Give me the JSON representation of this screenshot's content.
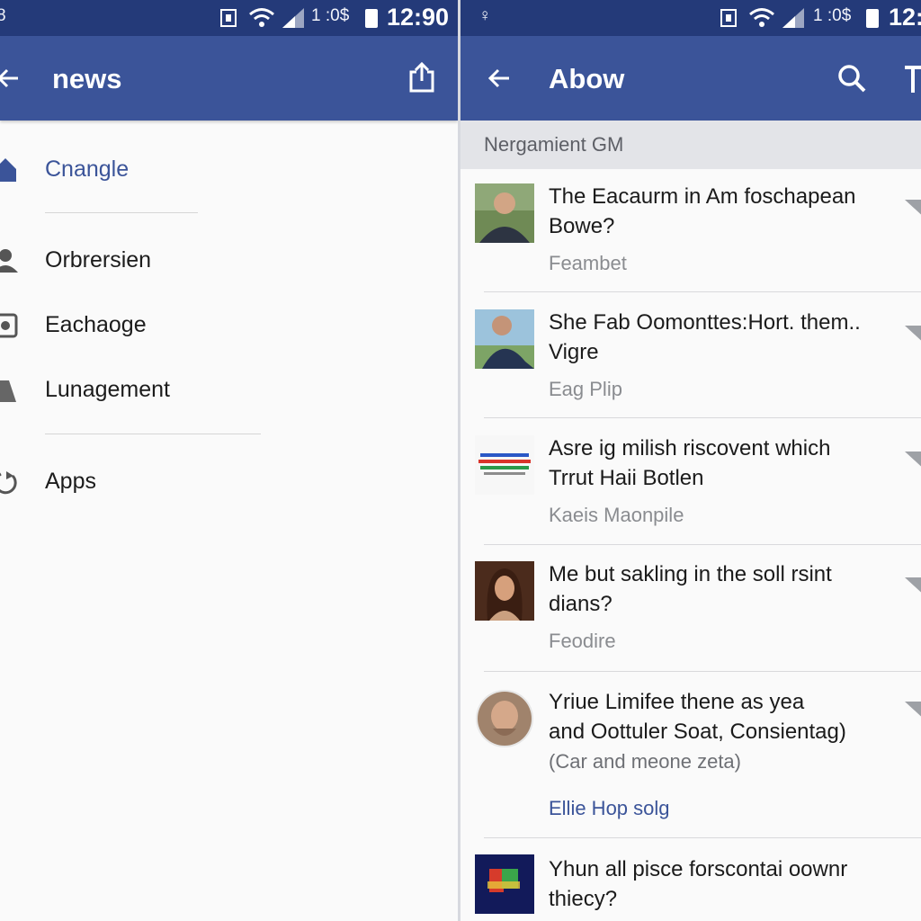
{
  "left_screen": {
    "status_bar": {
      "left_glyph": "8",
      "battery_text": "1 :0$",
      "time": "12:90"
    },
    "app_bar": {
      "title": "news",
      "back_icon": "arrow-left-icon",
      "share_icon": "share-icon"
    },
    "menu": {
      "items": [
        {
          "label": "Cnangle",
          "icon": "home-icon",
          "active": true
        },
        {
          "label": "Orbrersien",
          "icon": "person-icon"
        },
        {
          "label": "Eachaoge",
          "icon": "camera-icon"
        },
        {
          "label": "Lunagement",
          "icon": "tag-icon"
        },
        {
          "label": "Apps",
          "icon": "apps-icon"
        }
      ]
    }
  },
  "right_screen": {
    "status_bar": {
      "left_glyph": "♀",
      "battery_text": "1 :0$",
      "time": "12:"
    },
    "app_bar": {
      "title": "Abow",
      "back_icon": "arrow-left-icon",
      "search_icon": "search-icon",
      "overflow_icon": "more-icon"
    },
    "subheader": "Nergamient GM",
    "posts": [
      {
        "line1": "The Eacaurm in Am foschapean",
        "line2": "Bowe?",
        "meta": "Feambet",
        "thumb": "man-photo"
      },
      {
        "line1": "She Fab Oomonttes:Hort. them..",
        "line2": "Vigre",
        "meta": "Eag Plip",
        "thumb": "man-photo-2"
      },
      {
        "line1": "Asre ig milish riscovent which",
        "line2": "Trrut Haii Botlen",
        "meta": "Kaeis Maonpile",
        "thumb": "text-logo"
      },
      {
        "line1": "Me but sakling in the soll rsint",
        "line2": "dians?",
        "meta": "Feodire",
        "thumb": "woman-photo"
      },
      {
        "line1": "Yriue Limifee thene as yea",
        "line2": "and Oottuler Soat, Consientag)",
        "line3": "(Car and meone zeta)",
        "meta": "Ellie Hop solg",
        "thumb": "round-avatar"
      },
      {
        "line1": "Yhun all pisce forscontai oownr",
        "line2": "thiecy?",
        "thumb": "color-logo"
      }
    ],
    "colors": {
      "primary": "#3b5499",
      "status": "#243a79",
      "link": "#3b5499"
    }
  }
}
